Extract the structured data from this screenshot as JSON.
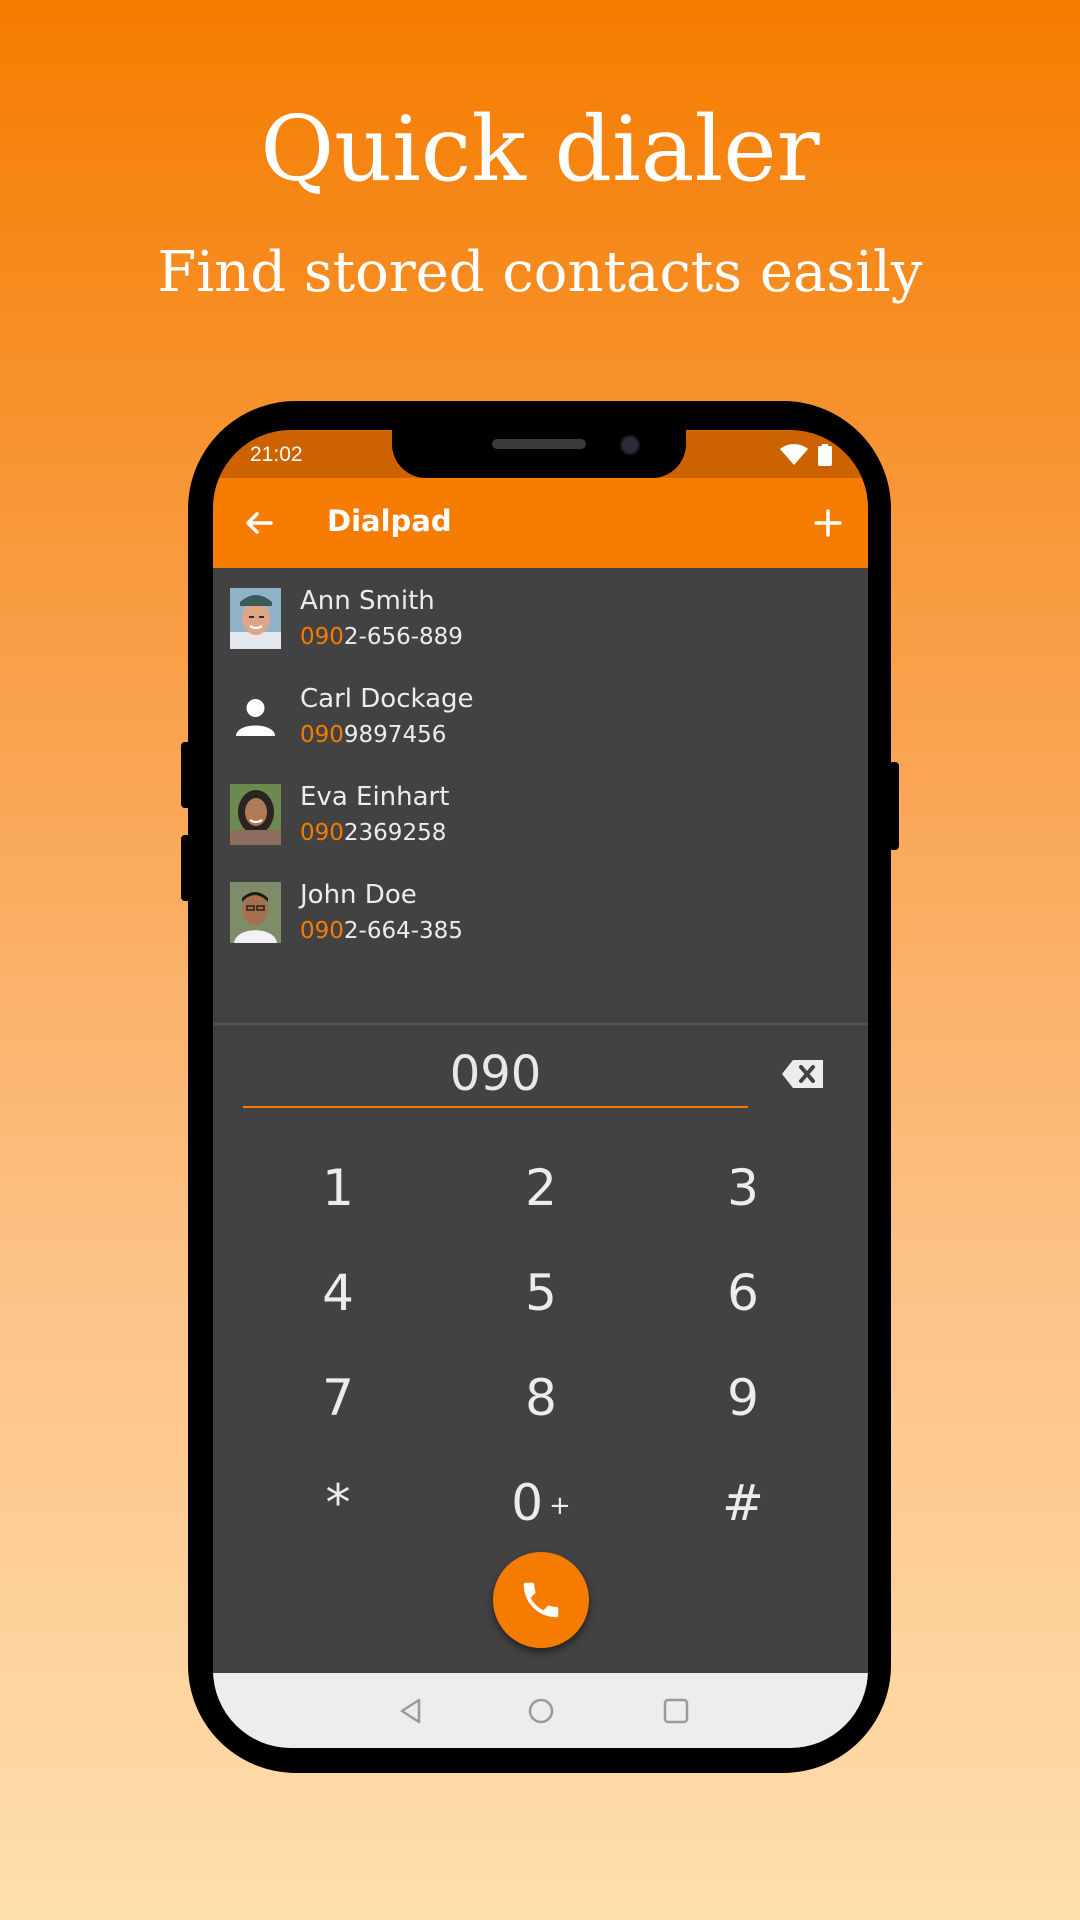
{
  "promo": {
    "title": "Quick dialer",
    "subtitle": "Find stored contacts easily"
  },
  "status_bar": {
    "time": "21:02",
    "icons": [
      "wifi-icon",
      "battery-icon"
    ]
  },
  "app_bar": {
    "title": "Dialpad",
    "back_icon": "arrow-back-icon",
    "add_icon": "plus-icon"
  },
  "contacts": [
    {
      "name": "Ann Smith",
      "number_match": "090",
      "number_rest": "2-656-889",
      "avatar": "photo"
    },
    {
      "name": "Carl Dockage",
      "number_match": "090",
      "number_rest": "9897456",
      "avatar": "person-placeholder-icon"
    },
    {
      "name": "Eva Einhart",
      "number_match": "090",
      "number_rest": "2369258",
      "avatar": "photo"
    },
    {
      "name": "John Doe",
      "number_match": "090",
      "number_rest": "2-664-385",
      "avatar": "photo"
    }
  ],
  "dialer": {
    "input_value": "090",
    "keys": [
      {
        "label": "1",
        "sub": ""
      },
      {
        "label": "2",
        "sub": ""
      },
      {
        "label": "3",
        "sub": ""
      },
      {
        "label": "4",
        "sub": ""
      },
      {
        "label": "5",
        "sub": ""
      },
      {
        "label": "6",
        "sub": ""
      },
      {
        "label": "7",
        "sub": ""
      },
      {
        "label": "8",
        "sub": ""
      },
      {
        "label": "9",
        "sub": ""
      },
      {
        "label": "*",
        "sub": ""
      },
      {
        "label": "0",
        "sub": "+"
      },
      {
        "label": "#",
        "sub": ""
      }
    ]
  },
  "colors": {
    "accent": "#f57c00",
    "status_bar": "#cc6300",
    "screen_bg": "#424242",
    "text": "#ececec"
  }
}
